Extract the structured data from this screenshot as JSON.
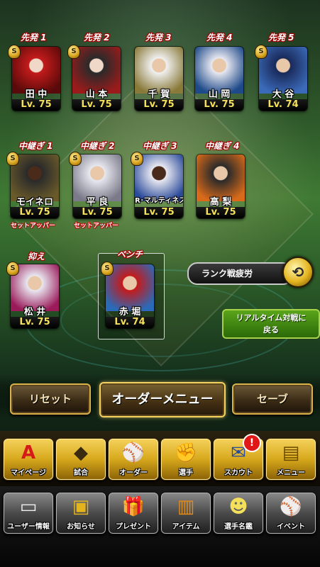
{
  "starters": [
    {
      "label": "先発 1",
      "name": "田 中",
      "lv": "Lv. 75",
      "color": "#c41b1b",
      "badge": "S"
    },
    {
      "label": "先発 2",
      "name": "山 本",
      "lv": "Lv. 75",
      "color": "#9b1b1b",
      "badge": "S"
    },
    {
      "label": "先発 3",
      "name": "千 賀",
      "lv": "Lv. 75",
      "color": "#8a7a3a",
      "badge": "S"
    },
    {
      "label": "先発 4",
      "name": "山 岡",
      "lv": "Lv. 75",
      "color": "#1e4a8a",
      "badge": "S"
    },
    {
      "label": "先発 5",
      "name": "大 谷",
      "lv": "Lv. 74",
      "color": "#3a6ab8",
      "badge": "S"
    }
  ],
  "relievers": [
    {
      "label": "中継ぎ 1",
      "name": "モイネロ",
      "lv": "Lv. 75",
      "sub": "セットアッパー",
      "color": "#6a5a2a",
      "badge": "S"
    },
    {
      "label": "中継ぎ 2",
      "name": "平 良",
      "lv": "Lv. 75",
      "sub": "セットアッパー",
      "color": "#c8c8d8",
      "badge": "S"
    },
    {
      "label": "中継ぎ 3",
      "name": "R･マルティネス",
      "lv": "Lv. 75",
      "sub": "",
      "color": "#2a4a9a",
      "badge": "S"
    },
    {
      "label": "中継ぎ 4",
      "name": "高 梨",
      "lv": "Lv. 75",
      "sub": "",
      "color": "#d86a1a",
      "badge": "S"
    }
  ],
  "closer": {
    "label": "抑え",
    "name": "松 井",
    "lv": "Lv. 75",
    "color": "#9a1a5a",
    "badge": "S"
  },
  "bench": {
    "label": "ベンチ",
    "name": "赤 堀",
    "lv": "Lv. 74",
    "color": "#2a6ab8",
    "badge": "S"
  },
  "rank_fatigue": {
    "label": "ランク戦疲労"
  },
  "realtime_button": {
    "line1": "リアルタイム対戦に",
    "line2": "戻る"
  },
  "order_buttons": {
    "reset": "リセット",
    "order_menu": "オーダーメニュー",
    "save": "セーブ"
  },
  "menu_row1": [
    {
      "label": "マイページ",
      "icon": "A"
    },
    {
      "label": "試合",
      "icon": "◆"
    },
    {
      "label": "オーダー",
      "icon": "⚾"
    },
    {
      "label": "選手",
      "icon": "✊"
    },
    {
      "label": "スカウト",
      "icon": "✉"
    },
    {
      "label": "メニュー",
      "icon": "▤"
    }
  ],
  "menu_row2": [
    {
      "label": "ユーザー情報",
      "icon": "▭"
    },
    {
      "label": "お知らせ",
      "icon": "▣"
    },
    {
      "label": "プレゼント",
      "icon": "🎁"
    },
    {
      "label": "アイテム",
      "icon": "▥"
    },
    {
      "label": "選手名鑑",
      "icon": "☻"
    },
    {
      "label": "イベント",
      "icon": "⚾"
    }
  ],
  "scout_badge": "!"
}
